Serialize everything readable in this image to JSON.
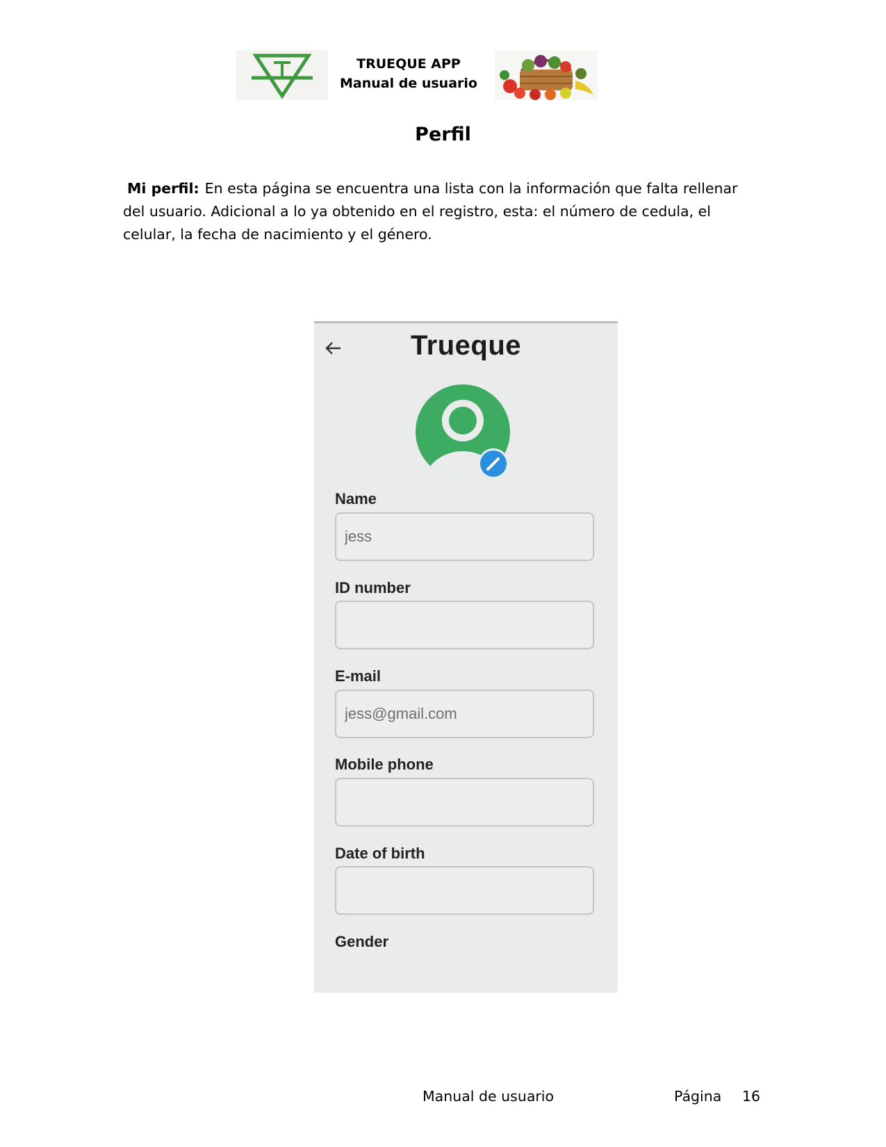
{
  "header": {
    "line1": "TRUEQUE APP",
    "line2": "Manual de usuario",
    "logo_letter": "T",
    "logo_color": "#3f9a3e"
  },
  "section": {
    "title": "Perfil"
  },
  "paragraph": {
    "lead": "Mi perfil:",
    "text": "En esta página se encuentra una lista con la información que falta rellenar del usuario. Adicional a lo ya obtenido en el registro, esta: el número de cedula, el celular, la fecha de nacimiento y el género."
  },
  "app": {
    "title": "Trueque",
    "back_icon": "arrow-left-icon",
    "avatar_color": "#3dac62",
    "edit_badge_color": "#2b8fdf",
    "fields": [
      {
        "label": "Name",
        "value": "jess",
        "placeholder": ""
      },
      {
        "label": "ID number",
        "value": "",
        "placeholder": ""
      },
      {
        "label": "E-mail",
        "value": "jess@gmail.com",
        "placeholder": ""
      },
      {
        "label": "Mobile phone",
        "value": "",
        "placeholder": ""
      },
      {
        "label": "Date of birth",
        "value": "",
        "placeholder": ""
      }
    ],
    "gender_label": "Gender"
  },
  "footer": {
    "left": "Manual de usuario",
    "page_label": "Página",
    "page_number": "16"
  }
}
